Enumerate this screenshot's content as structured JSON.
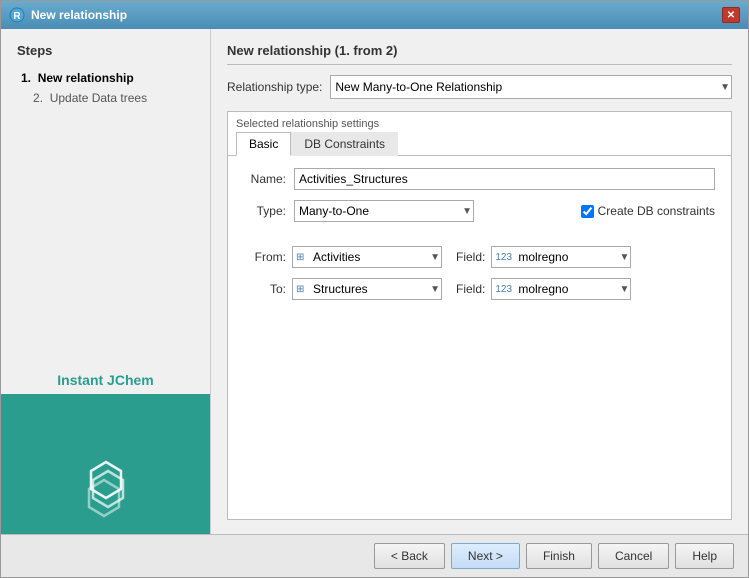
{
  "dialog": {
    "title": "New relationship",
    "close_label": "✕"
  },
  "sidebar": {
    "steps_title": "Steps",
    "step1_label": "New relationship",
    "step1_number": "1.",
    "step2_label": "Update Data trees",
    "step2_number": "2.",
    "brand_name": "Instant JChem"
  },
  "panel": {
    "title": "New relationship (1. from 2)",
    "rel_type_label": "Relationship type:",
    "rel_type_value": "New Many-to-One Relationship",
    "settings_label": "Selected relationship settings",
    "tab_basic": "Basic",
    "tab_db_constraints": "DB Constraints",
    "name_label": "Name:",
    "name_value": "Activities_Structures",
    "type_label": "Type:",
    "type_value": "Many-to-One",
    "create_db_label": "Create DB constraints",
    "from_label": "From:",
    "from_value": "Activities",
    "from_field_label": "Field:",
    "from_field_value": "molregno",
    "to_label": "To:",
    "to_value": "Structures",
    "to_field_label": "Field:",
    "to_field_value": "molregno"
  },
  "footer": {
    "back_label": "< Back",
    "next_label": "Next >",
    "finish_label": "Finish",
    "cancel_label": "Cancel",
    "help_label": "Help"
  }
}
